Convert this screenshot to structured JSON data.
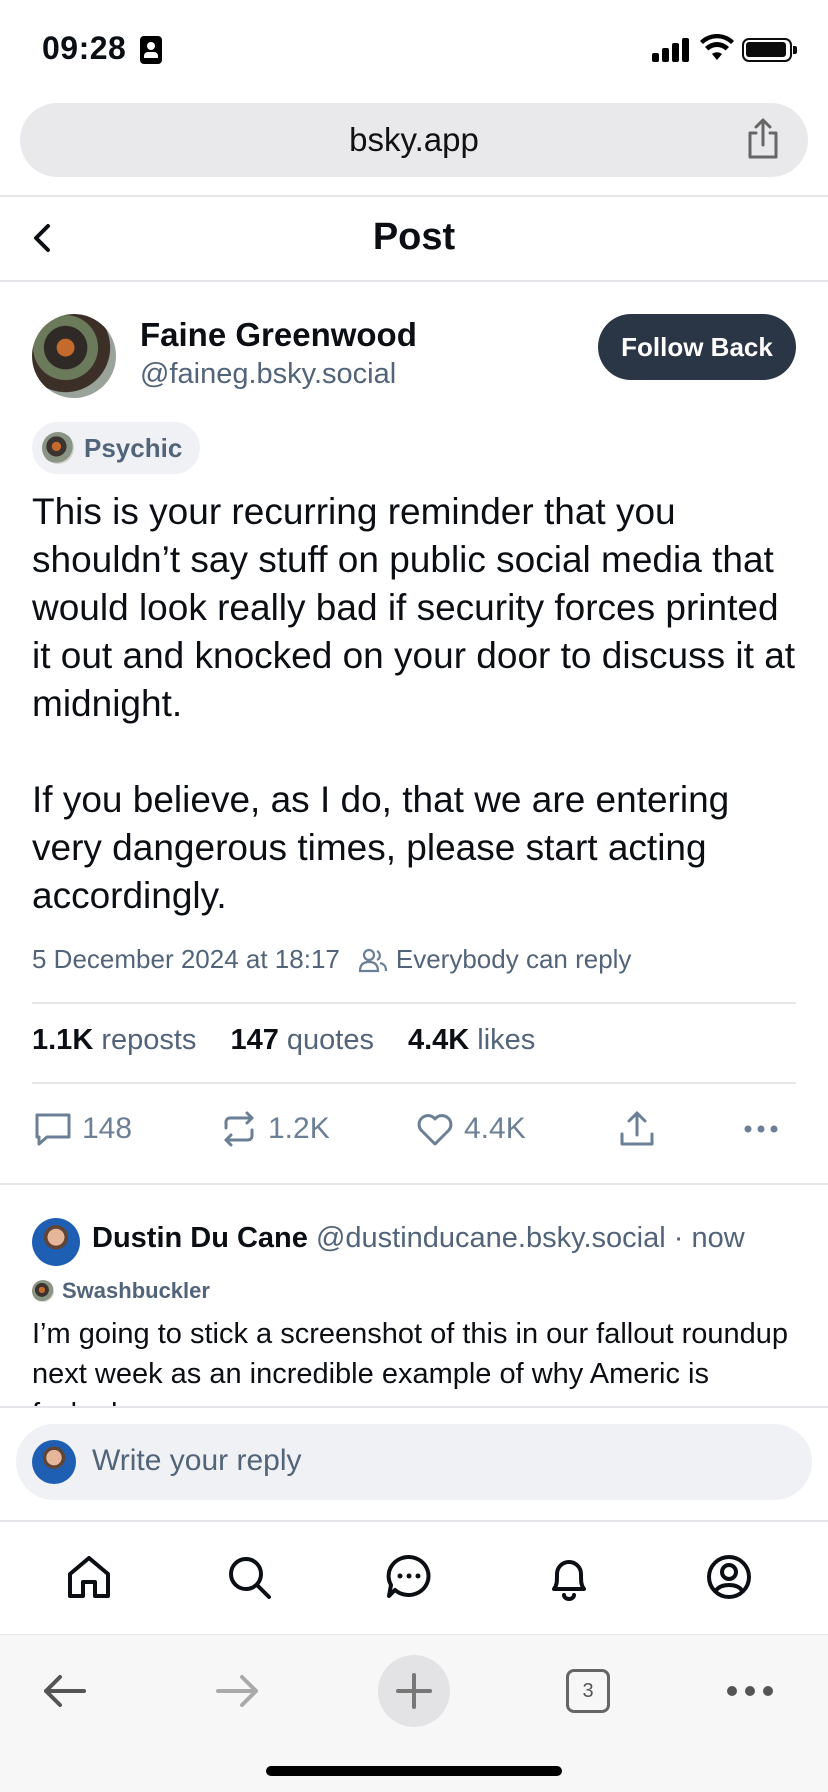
{
  "status": {
    "time": "09:28"
  },
  "browser": {
    "url": "bsky.app",
    "tab_count": "3"
  },
  "header": {
    "title": "Post"
  },
  "post": {
    "author_name": "Faine Greenwood",
    "author_handle": "@faineg.bsky.social",
    "follow_label": "Follow Back",
    "label": "Psychic",
    "paragraphs": [
      "This is your recurring reminder that you shouldn’t say stuff on public social media that would look really bad if security forces printed it out and knocked on your door to discuss it at midnight.",
      "If you believe, as I do, that we are entering very dangerous times, please start acting accordingly."
    ],
    "timestamp": "5 December 2024 at 18:17",
    "reply_setting": "Everybody can reply",
    "stats": {
      "reposts_count": "1.1K",
      "reposts_label": "reposts",
      "quotes_count": "147",
      "quotes_label": "quotes",
      "likes_count": "4.4K",
      "likes_label": "likes"
    },
    "actions": {
      "replies": "148",
      "reposts": "1.2K",
      "likes": "4.4K"
    }
  },
  "reply": {
    "author_name": "Dustin Du Cane",
    "author_handle": "@dustinducane.bsky.social",
    "time": "· now",
    "label": "Swashbuckler",
    "text": "I’m going to stick a screenshot of this in our fallout roundup next week as an incredible example of why Americ is fucked"
  },
  "composer": {
    "placeholder": "Write your reply"
  },
  "colors": {
    "accent_dark": "#2a3545",
    "muted": "#52647a",
    "icon": "#6b7f96"
  },
  "icons": {
    "nav": [
      "home-icon",
      "search-icon",
      "chat-icon",
      "bell-icon",
      "profile-icon"
    ],
    "browser": [
      "back-arrow-icon",
      "forward-arrow-icon",
      "add-tab-icon",
      "tabs-icon",
      "more-icon"
    ]
  }
}
